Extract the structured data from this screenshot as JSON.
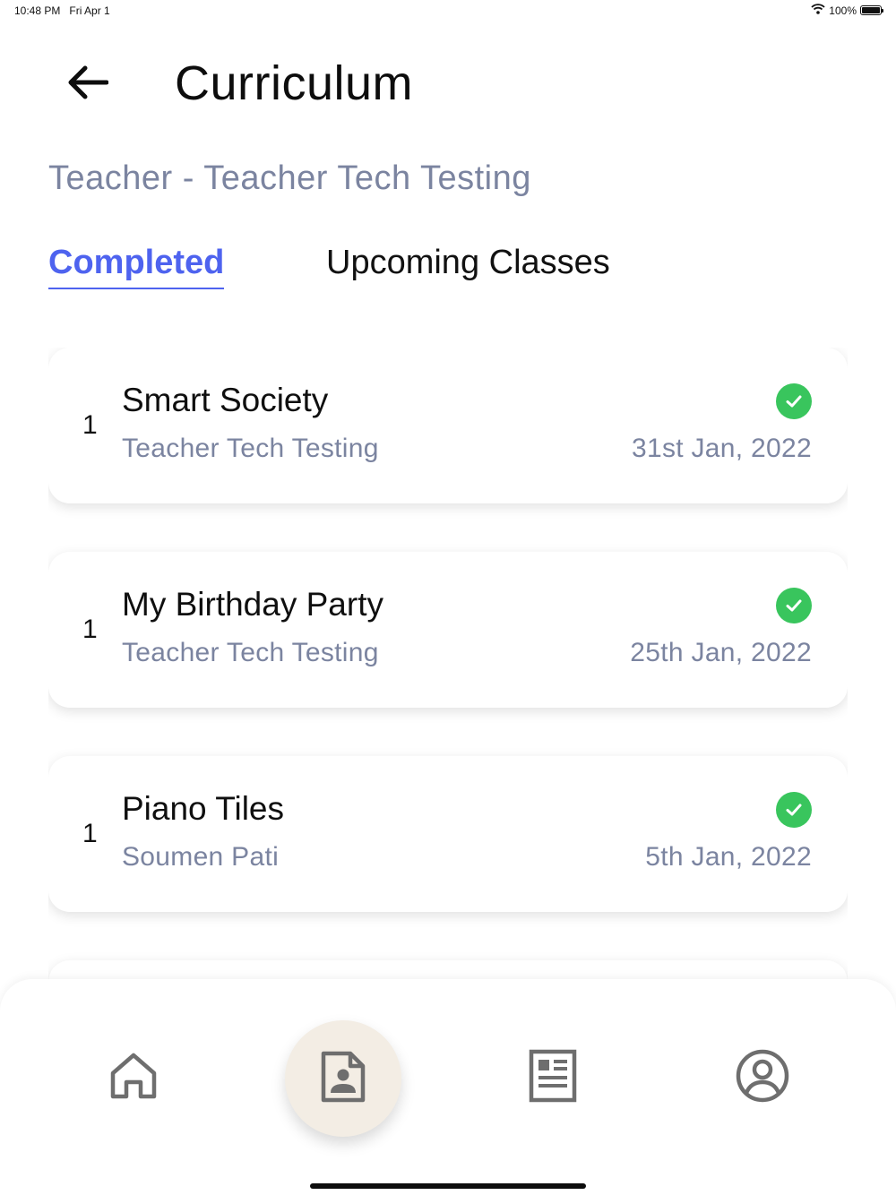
{
  "status_bar": {
    "time": "10:48 PM",
    "date": "Fri Apr 1",
    "battery_text": "100%",
    "battery_level": 1.0
  },
  "header": {
    "title": "Curriculum",
    "back_icon": "arrow-left-icon"
  },
  "subtitle": "Teacher - Teacher Tech Testing",
  "tabs": [
    {
      "label": "Completed",
      "active": true
    },
    {
      "label": "Upcoming Classes",
      "active": false
    }
  ],
  "classes": [
    {
      "index": "1",
      "title": "Smart Society",
      "teacher": "Teacher Tech Testing",
      "date": "31st Jan, 2022",
      "status_icon": "check-circle-icon"
    },
    {
      "index": "1",
      "title": "My Birthday Party",
      "teacher": "Teacher Tech Testing",
      "date": "25th Jan, 2022",
      "status_icon": "check-circle-icon"
    },
    {
      "index": "1",
      "title": "Piano Tiles",
      "teacher": "Soumen Pati",
      "date": "5th Jan, 2022",
      "status_icon": "check-circle-icon"
    }
  ],
  "bottom_nav": {
    "items": [
      {
        "icon": "home-icon",
        "active": false
      },
      {
        "icon": "curriculum-icon",
        "active": true
      },
      {
        "icon": "reports-icon",
        "active": false
      },
      {
        "icon": "profile-icon",
        "active": false
      }
    ]
  },
  "colors": {
    "accent": "#4e63ef",
    "muted_text": "#7b84a0",
    "success": "#39c55d",
    "active_nav_bg": "#f3ede4",
    "icon_gray": "#6e6e6e"
  }
}
